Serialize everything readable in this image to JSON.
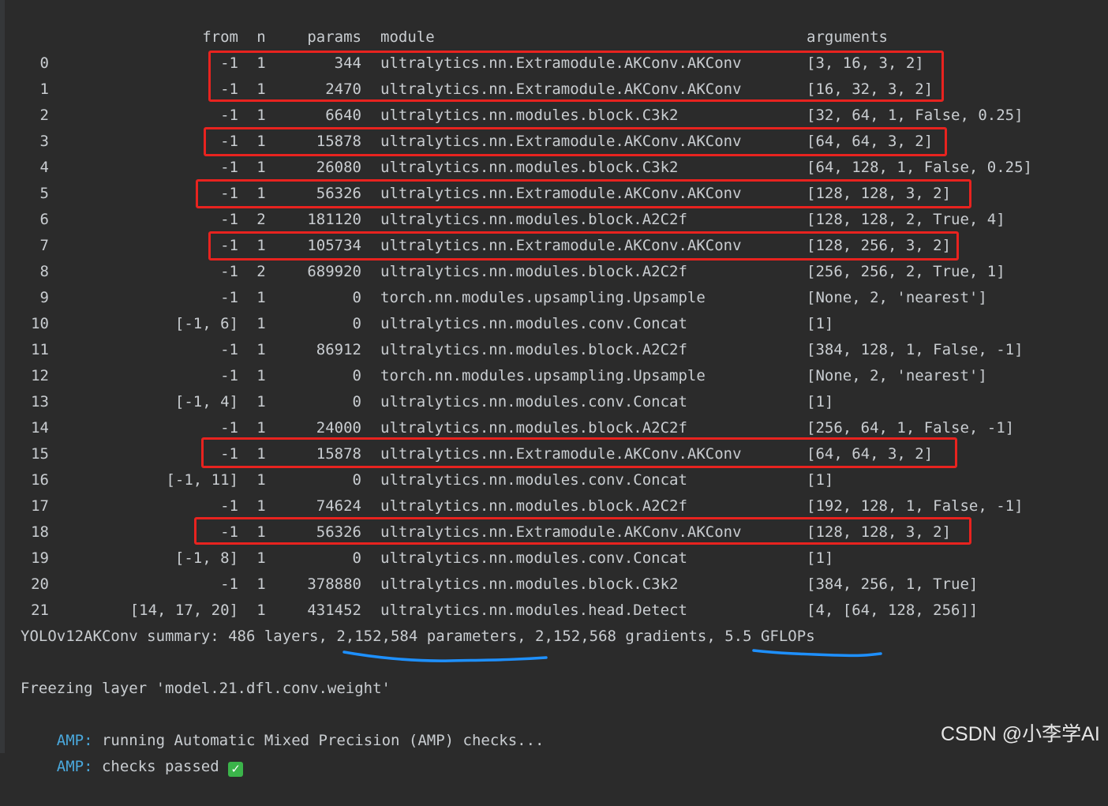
{
  "headers": {
    "from": "from",
    "n": "n",
    "params": "params",
    "module": "module",
    "arguments": "arguments"
  },
  "rows": [
    {
      "idx": "0",
      "from": "-1",
      "n": "1",
      "params": "344",
      "module": "ultralytics.nn.Extramodule.AKConv.AKConv",
      "args": "[3, 16, 3, 2]"
    },
    {
      "idx": "1",
      "from": "-1",
      "n": "1",
      "params": "2470",
      "module": "ultralytics.nn.Extramodule.AKConv.AKConv",
      "args": "[16, 32, 3, 2]"
    },
    {
      "idx": "2",
      "from": "-1",
      "n": "1",
      "params": "6640",
      "module": "ultralytics.nn.modules.block.C3k2",
      "args": "[32, 64, 1, False, 0.25]"
    },
    {
      "idx": "3",
      "from": "-1",
      "n": "1",
      "params": "15878",
      "module": "ultralytics.nn.Extramodule.AKConv.AKConv",
      "args": "[64, 64, 3, 2]"
    },
    {
      "idx": "4",
      "from": "-1",
      "n": "1",
      "params": "26080",
      "module": "ultralytics.nn.modules.block.C3k2",
      "args": "[64, 128, 1, False, 0.25]"
    },
    {
      "idx": "5",
      "from": "-1",
      "n": "1",
      "params": "56326",
      "module": "ultralytics.nn.Extramodule.AKConv.AKConv",
      "args": "[128, 128, 3, 2]"
    },
    {
      "idx": "6",
      "from": "-1",
      "n": "2",
      "params": "181120",
      "module": "ultralytics.nn.modules.block.A2C2f",
      "args": "[128, 128, 2, True, 4]"
    },
    {
      "idx": "7",
      "from": "-1",
      "n": "1",
      "params": "105734",
      "module": "ultralytics.nn.Extramodule.AKConv.AKConv",
      "args": "[128, 256, 3, 2]"
    },
    {
      "idx": "8",
      "from": "-1",
      "n": "2",
      "params": "689920",
      "module": "ultralytics.nn.modules.block.A2C2f",
      "args": "[256, 256, 2, True, 1]"
    },
    {
      "idx": "9",
      "from": "-1",
      "n": "1",
      "params": "0",
      "module": "torch.nn.modules.upsampling.Upsample",
      "args": "[None, 2, 'nearest']"
    },
    {
      "idx": "10",
      "from": "[-1, 6]",
      "n": "1",
      "params": "0",
      "module": "ultralytics.nn.modules.conv.Concat",
      "args": "[1]"
    },
    {
      "idx": "11",
      "from": "-1",
      "n": "1",
      "params": "86912",
      "module": "ultralytics.nn.modules.block.A2C2f",
      "args": "[384, 128, 1, False, -1]"
    },
    {
      "idx": "12",
      "from": "-1",
      "n": "1",
      "params": "0",
      "module": "torch.nn.modules.upsampling.Upsample",
      "args": "[None, 2, 'nearest']"
    },
    {
      "idx": "13",
      "from": "[-1, 4]",
      "n": "1",
      "params": "0",
      "module": "ultralytics.nn.modules.conv.Concat",
      "args": "[1]"
    },
    {
      "idx": "14",
      "from": "-1",
      "n": "1",
      "params": "24000",
      "module": "ultralytics.nn.modules.block.A2C2f",
      "args": "[256, 64, 1, False, -1]"
    },
    {
      "idx": "15",
      "from": "-1",
      "n": "1",
      "params": "15878",
      "module": "ultralytics.nn.Extramodule.AKConv.AKConv",
      "args": "[64, 64, 3, 2]"
    },
    {
      "idx": "16",
      "from": "[-1, 11]",
      "n": "1",
      "params": "0",
      "module": "ultralytics.nn.modules.conv.Concat",
      "args": "[1]"
    },
    {
      "idx": "17",
      "from": "-1",
      "n": "1",
      "params": "74624",
      "module": "ultralytics.nn.modules.block.A2C2f",
      "args": "[192, 128, 1, False, -1]"
    },
    {
      "idx": "18",
      "from": "-1",
      "n": "1",
      "params": "56326",
      "module": "ultralytics.nn.Extramodule.AKConv.AKConv",
      "args": "[128, 128, 3, 2]"
    },
    {
      "idx": "19",
      "from": "[-1, 8]",
      "n": "1",
      "params": "0",
      "module": "ultralytics.nn.modules.conv.Concat",
      "args": "[1]"
    },
    {
      "idx": "20",
      "from": "-1",
      "n": "1",
      "params": "378880",
      "module": "ultralytics.nn.modules.block.C3k2",
      "args": "[384, 256, 1, True]"
    },
    {
      "idx": "21",
      "from": "[14, 17, 20]",
      "n": "1",
      "params": "431452",
      "module": "ultralytics.nn.modules.head.Detect",
      "args": "[4, [64, 128, 256]]"
    }
  ],
  "summary": "YOLOv12AKConv summary: 486 layers, 2,152,584 parameters, 2,152,568 gradients, 5.5 GFLOPs",
  "freezing": "Freezing layer 'model.21.dfl.conv.weight'",
  "amp_lines": [
    {
      "label": "AMP:",
      "text": " running Automatic Mixed Precision (AMP) checks..."
    },
    {
      "label": "AMP:",
      "text": " checks passed "
    }
  ],
  "watermark": "CSDN @小李学AI",
  "colors": {
    "background": "#2b2b2b",
    "text": "#c9cdd1",
    "highlight_box": "#e8231f",
    "underline": "#1e90ff",
    "amp_label": "#4aa8dc",
    "check": "#3bb44a"
  },
  "icons": {
    "check": "white-check-mark-icon"
  }
}
